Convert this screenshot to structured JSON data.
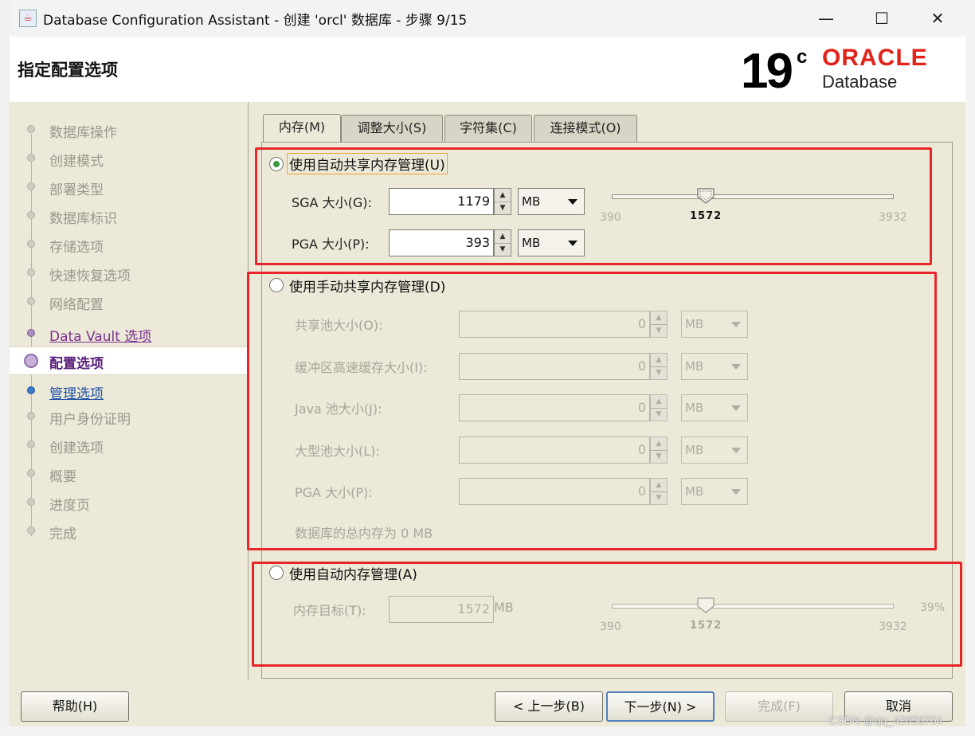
{
  "window": {
    "title": "Database Configuration Assistant - 创建 'orcl' 数据库 - 步骤 9/15",
    "minimize": "—",
    "maximize": "☐",
    "close": "✕"
  },
  "header": {
    "page_title": "指定配置选项",
    "logo_version": "19",
    "logo_superscript": "c",
    "logo_brand": "ORACLE",
    "logo_product": "Database"
  },
  "nav": {
    "items": [
      {
        "label": "数据库操作",
        "state": "disabled"
      },
      {
        "label": "创建模式",
        "state": "disabled"
      },
      {
        "label": "部署类型",
        "state": "disabled"
      },
      {
        "label": "数据库标识",
        "state": "disabled"
      },
      {
        "label": "存储选项",
        "state": "disabled"
      },
      {
        "label": "快速恢复选项",
        "state": "disabled"
      },
      {
        "label": "网络配置",
        "state": "disabled"
      },
      {
        "label": "Data Vault 选项",
        "state": "done"
      },
      {
        "label": "配置选项",
        "state": "current"
      },
      {
        "label": "管理选项",
        "state": "next"
      },
      {
        "label": "用户身份证明",
        "state": "disabled"
      },
      {
        "label": "创建选项",
        "state": "disabled"
      },
      {
        "label": "概要",
        "state": "disabled"
      },
      {
        "label": "进度页",
        "state": "disabled"
      },
      {
        "label": "完成",
        "state": "disabled"
      }
    ]
  },
  "tabs": [
    {
      "label": "内存(M)"
    },
    {
      "label": "调整大小(S)"
    },
    {
      "label": "字符集(C)"
    },
    {
      "label": "连接模式(O)"
    }
  ],
  "asmm": {
    "label": "使用自动共享内存管理(U)",
    "selected": true,
    "sga_label": "SGA 大小(G):",
    "sga_value": "1179",
    "sga_unit": "MB",
    "pga_label": "PGA 大小(P):",
    "pga_value": "393",
    "pga_unit": "MB",
    "slider_value": "1572",
    "slider_min": "390",
    "slider_max": "3932"
  },
  "manual": {
    "label": "使用手动共享内存管理(D)",
    "selected": false,
    "fields": [
      {
        "label": "共享池大小(O):",
        "value": "0",
        "unit": "MB"
      },
      {
        "label": "缓冲区高速缓存大小(I):",
        "value": "0",
        "unit": "MB"
      },
      {
        "label": "Java 池大小(J):",
        "value": "0",
        "unit": "MB"
      },
      {
        "label": "大型池大小(L):",
        "value": "0",
        "unit": "MB"
      },
      {
        "label": "PGA 大小(P):",
        "value": "0",
        "unit": "MB"
      }
    ],
    "total": "数据库的总内存为 0 MB"
  },
  "amm": {
    "label": "使用自动内存管理(A)",
    "selected": false,
    "target_label": "内存目标(T):",
    "target_value": "1572",
    "target_unit": "MB",
    "slider_value": "1572",
    "slider_min": "390",
    "slider_max": "3932",
    "percent": "39%"
  },
  "buttons": {
    "help": "帮助(H)",
    "back": "< 上一步(B)",
    "next": "下一步(N) >",
    "finish": "完成(F)",
    "cancel": "取消"
  },
  "watermark": "CSDN @qq_42658764",
  "colors": {
    "highlight_box": "#e8262a",
    "oracle_red": "#e2231a",
    "nav_current": "#5a1f7a",
    "nav_next": "#1f4fa6"
  }
}
